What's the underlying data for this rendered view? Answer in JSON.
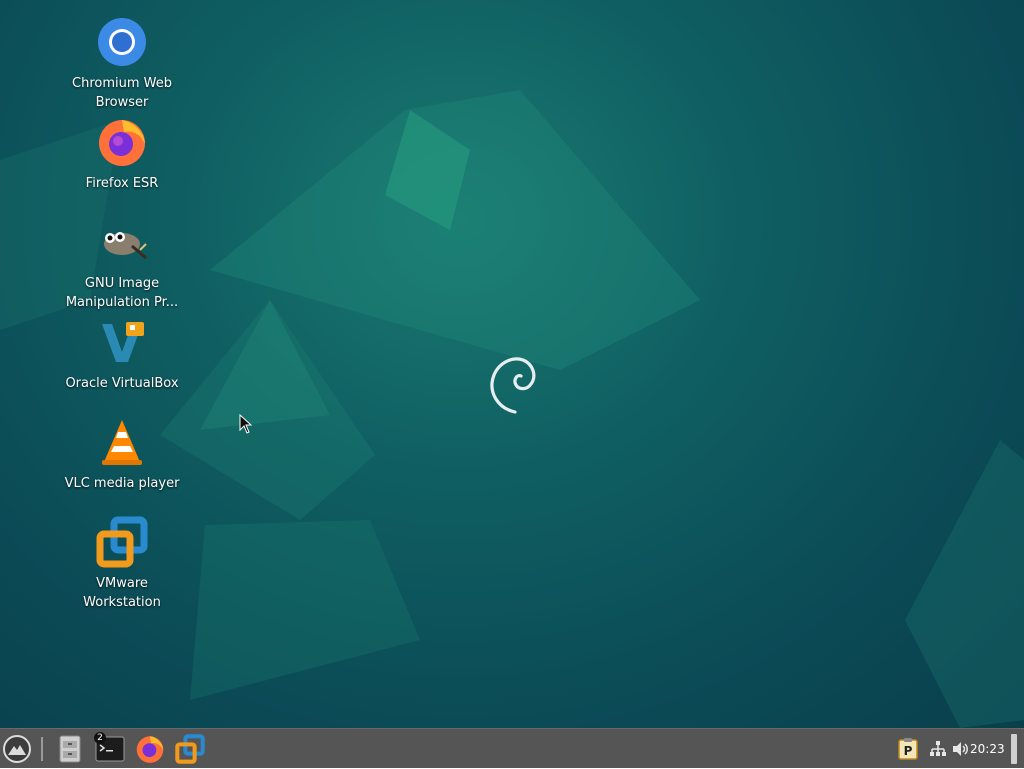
{
  "desktop": {
    "icons": [
      {
        "label": "Chromium Web Browser",
        "icon": "chromium-icon"
      },
      {
        "label": "Firefox ESR",
        "icon": "firefox-icon"
      },
      {
        "label": "GNU Image Manipulation Pr...",
        "icon": "gimp-icon"
      },
      {
        "label": "Oracle VirtualBox",
        "icon": "virtualbox-icon"
      },
      {
        "label": "VLC media player",
        "icon": "vlc-icon"
      },
      {
        "label": "VMware Workstation",
        "icon": "vmware-icon"
      }
    ],
    "wallpaper_logo": "debian-swirl-logo"
  },
  "taskbar": {
    "start_icon": "app-menu-icon",
    "launchers": [
      {
        "name": "file-manager-icon"
      },
      {
        "name": "terminal-icon",
        "badge": "2"
      },
      {
        "name": "firefox-icon"
      },
      {
        "name": "vmware-icon"
      }
    ],
    "tray": {
      "items": [
        "clipboard-p-icon",
        "network-icon",
        "volume-icon"
      ],
      "clock": "20:23"
    }
  },
  "colors": {
    "taskbar_bg": "#555555",
    "desktop_bg": "#0f5f62",
    "label_text": "#ffffff"
  }
}
